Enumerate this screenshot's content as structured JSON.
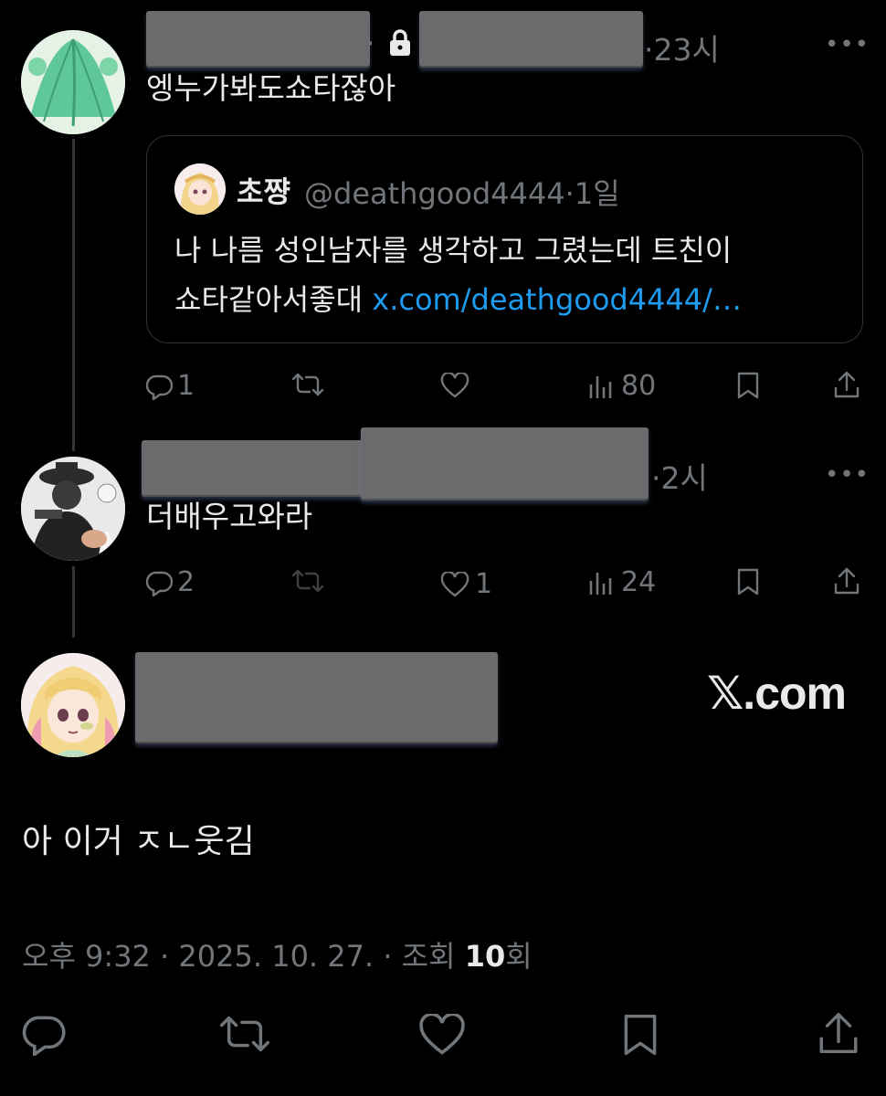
{
  "reply1": {
    "time": "23시",
    "text": "엥누가봐도쇼타잖아",
    "quote": {
      "name": "초쨩",
      "handle": "@deathgood4444",
      "time": "1일",
      "line1": "나 나름 성인남자를 생각하고 그렸는데 트친이",
      "line2_text": "쇼타같아서좋대",
      "line2_link": "x.com/deathgood4444/…"
    },
    "replies": "1",
    "retweets": "",
    "likes": "",
    "views": "80"
  },
  "reply2": {
    "time": "2시",
    "text": "더배우고와라",
    "replies": "2",
    "retweets": "",
    "likes": "1",
    "views": "24"
  },
  "main": {
    "watermark": "𝕏.com",
    "text": "아 이거 ㅈㄴ웃김",
    "timestamp": "오후 9:32 · 2025. 10. 27. · 조회",
    "views_count": "10",
    "views_suffix": "회"
  },
  "colors": {
    "background": "#000000",
    "text": "#e7e9ea",
    "muted": "#71767b",
    "link": "#1d9bf0",
    "border": "#2f3336"
  },
  "icons": {
    "lock": "lock-icon",
    "reply": "reply-icon",
    "retweet": "retweet-icon",
    "like": "heart-icon",
    "views": "views-icon",
    "bookmark": "bookmark-icon",
    "share": "share-icon",
    "more": "more-icon"
  }
}
